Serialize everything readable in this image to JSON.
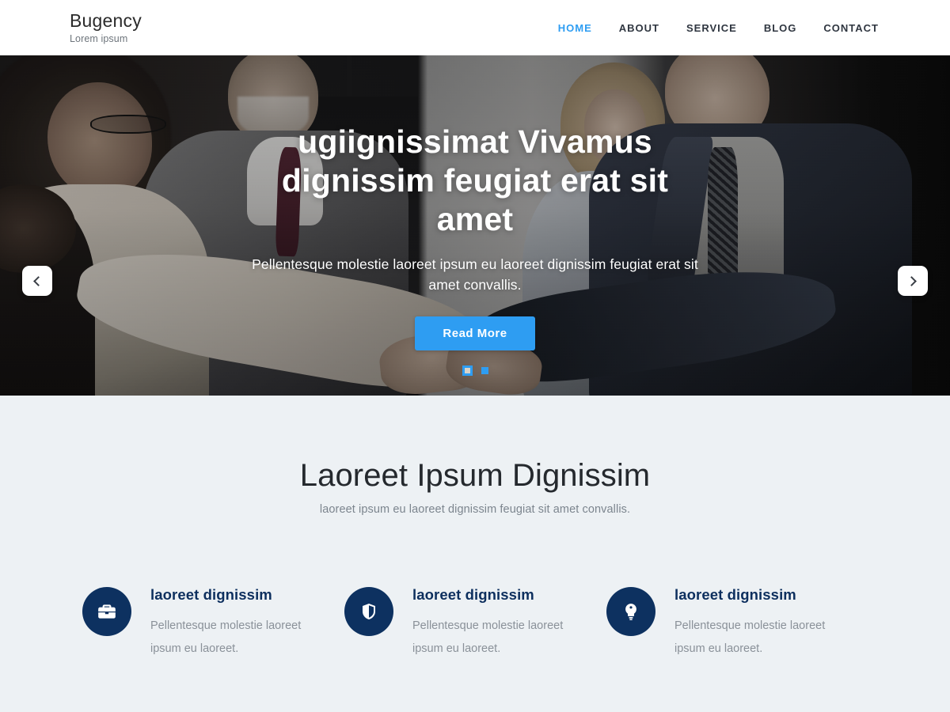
{
  "header": {
    "brand_name": "Bugency",
    "brand_tagline": "Lorem ipsum",
    "nav": [
      {
        "label": "HOME",
        "active": true
      },
      {
        "label": "ABOUT",
        "active": false
      },
      {
        "label": "SERVICE",
        "active": false
      },
      {
        "label": "BLOG",
        "active": false
      },
      {
        "label": "CONTACT",
        "active": false
      }
    ]
  },
  "hero": {
    "title": "ugiignissimat Vivamus dignissim feugiat erat sit amet",
    "subtitle": "Pellentesque molestie laoreet ipsum eu laoreet dignissim feugiat erat sit amet convallis.",
    "cta_label": "Read More",
    "prev_label": "Previous slide",
    "next_label": "Next slide",
    "slide_count": 2,
    "active_slide": 1,
    "accent_color": "#2e9df2"
  },
  "features": {
    "title": "Laoreet Ipsum Dignissim",
    "subtitle": "laoreet ipsum eu laoreet dignissim feugiat sit amet convallis.",
    "background_color": "#edf1f4",
    "icon_circle_color": "#0d3160",
    "cards": [
      {
        "icon": "briefcase-icon",
        "title": "laoreet dignissim",
        "text": "Pellentesque molestie laoreet ipsum eu laoreet."
      },
      {
        "icon": "shield-icon",
        "title": "laoreet dignissim",
        "text": "Pellentesque molestie laoreet ipsum eu laoreet."
      },
      {
        "icon": "lightbulb-icon",
        "title": "laoreet dignissim",
        "text": "Pellentesque molestie laoreet ipsum eu laoreet."
      }
    ]
  }
}
